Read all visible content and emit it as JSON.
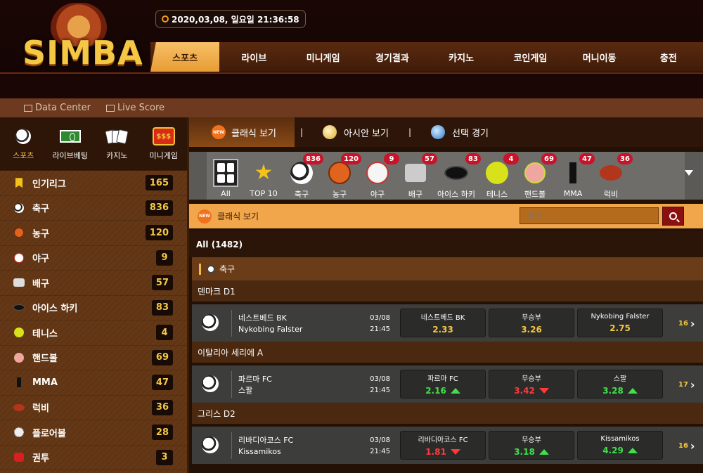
{
  "header": {
    "logo_text": "SIMBA",
    "datetime": "2020,03,08, 일요일 21:36:58",
    "nav": [
      "스포츠",
      "라이브",
      "미니게임",
      "경기결과",
      "카지노",
      "코인게임",
      "머니이동",
      "충전"
    ]
  },
  "subbar": {
    "data_center": "Data Center",
    "live_score": "Live Score"
  },
  "sidebar": {
    "tabs": [
      "스포츠",
      "라이브베팅",
      "카지노",
      "미니게임"
    ],
    "items": [
      {
        "label": "인기리그",
        "count": "165",
        "icon": "bookmark-icon"
      },
      {
        "label": "축구",
        "count": "836",
        "icon": "soccer-icon"
      },
      {
        "label": "농구",
        "count": "120",
        "icon": "basketball-icon"
      },
      {
        "label": "야구",
        "count": "9",
        "icon": "baseball-icon"
      },
      {
        "label": "배구",
        "count": "57",
        "icon": "volleyball-icon"
      },
      {
        "label": "아이스 하키",
        "count": "83",
        "icon": "hockey-icon"
      },
      {
        "label": "테니스",
        "count": "4",
        "icon": "tennis-icon"
      },
      {
        "label": "핸드볼",
        "count": "69",
        "icon": "handball-icon"
      },
      {
        "label": "MMA",
        "count": "47",
        "icon": "mma-icon"
      },
      {
        "label": "럭비",
        "count": "36",
        "icon": "rugby-icon"
      },
      {
        "label": "플로어볼",
        "count": "28",
        "icon": "floorball-icon"
      },
      {
        "label": "권투",
        "count": "3",
        "icon": "boxing-icon"
      }
    ]
  },
  "main": {
    "view_tabs": [
      "클래식 보기",
      "아시안 보기",
      "선택 경기"
    ],
    "new_badge": "NEW",
    "sports": [
      {
        "label": "All",
        "badge": ""
      },
      {
        "label": "TOP 10",
        "badge": ""
      },
      {
        "label": "축구",
        "badge": "836"
      },
      {
        "label": "농구",
        "badge": "120"
      },
      {
        "label": "야구",
        "badge": "9"
      },
      {
        "label": "배구",
        "badge": "57"
      },
      {
        "label": "아이스 하키",
        "badge": "83"
      },
      {
        "label": "테니스",
        "badge": "4"
      },
      {
        "label": "핸드볼",
        "badge": "69"
      },
      {
        "label": "MMA",
        "badge": "47"
      },
      {
        "label": "럭비",
        "badge": "36"
      }
    ],
    "section_title": "클래식 보기",
    "search_placeholder": "검색 . . .",
    "all_count": "All (1482)",
    "sport_header": "축구",
    "leagues": [
      {
        "name": "덴마크 D1",
        "home": "네스트베드 BK",
        "away": "Nykobing Falster",
        "date": "03/08",
        "time": "21:45",
        "odds": [
          {
            "name": "네스트베드 BK",
            "value": "2.33",
            "trend": ""
          },
          {
            "name": "무승부",
            "value": "3.26",
            "trend": ""
          },
          {
            "name": "Nykobing Falster",
            "value": "2.75",
            "trend": ""
          }
        ],
        "more": "16"
      },
      {
        "name": "이탈리아 세리에 A",
        "home": "파르마 FC",
        "away": "스팔",
        "date": "03/08",
        "time": "21:45",
        "odds": [
          {
            "name": "파르마 FC",
            "value": "2.16",
            "trend": "up"
          },
          {
            "name": "무승부",
            "value": "3.42",
            "trend": "down"
          },
          {
            "name": "스팔",
            "value": "3.28",
            "trend": "up"
          }
        ],
        "more": "17"
      },
      {
        "name": "그리스 D2",
        "home": "리바디아코스 FC",
        "away": "Kissamikos",
        "date": "03/08",
        "time": "21:45",
        "odds": [
          {
            "name": "리바디아코스 FC",
            "value": "1.81",
            "trend": "down"
          },
          {
            "name": "무승부",
            "value": "3.18",
            "trend": "up"
          },
          {
            "name": "Kissamikos",
            "value": "4.29",
            "trend": "up"
          }
        ],
        "more": "16"
      }
    ]
  }
}
